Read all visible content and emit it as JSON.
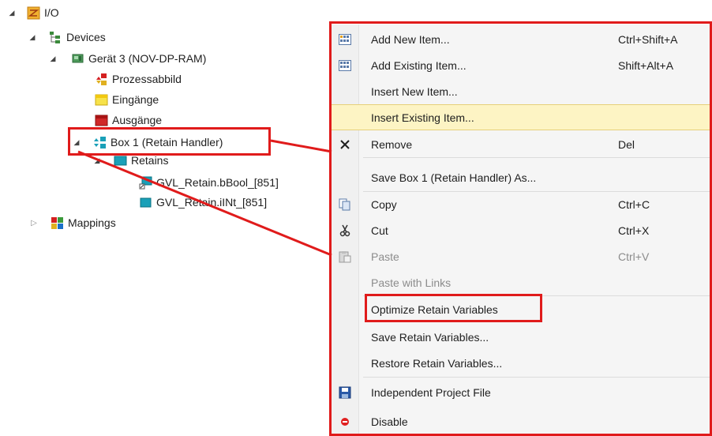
{
  "tree": {
    "io": "I/O",
    "devices": "Devices",
    "geraet": "Gerät 3 (NOV-DP-RAM)",
    "prozessabbild": "Prozessabbild",
    "eingaenge": "Eingänge",
    "ausgaenge": "Ausgänge",
    "box": "Box 1 (Retain Handler)",
    "retains": "Retains",
    "var1": "GVL_Retain.bBool_[851]",
    "var2": "GVL_Retain.iINt_[851]",
    "mappings": "Mappings"
  },
  "menu": {
    "add_new": {
      "label": "Add New Item...",
      "shortcut": "Ctrl+Shift+A"
    },
    "add_existing": {
      "label": "Add Existing Item...",
      "shortcut": "Shift+Alt+A"
    },
    "insert_new": {
      "label": "Insert New Item..."
    },
    "insert_existing": {
      "label": "Insert Existing Item..."
    },
    "remove": {
      "label": "Remove",
      "shortcut": "Del"
    },
    "save_as": {
      "label": "Save Box 1 (Retain Handler) As..."
    },
    "copy": {
      "label": "Copy",
      "shortcut": "Ctrl+C"
    },
    "cut": {
      "label": "Cut",
      "shortcut": "Ctrl+X"
    },
    "paste": {
      "label": "Paste",
      "shortcut": "Ctrl+V"
    },
    "paste_links": {
      "label": "Paste with Links"
    },
    "optimize": {
      "label": "Optimize Retain Variables"
    },
    "save_retain": {
      "label": "Save Retain Variables..."
    },
    "restore_retain": {
      "label": "Restore Retain Variables..."
    },
    "independent": {
      "label": "Independent Project File"
    },
    "disable": {
      "label": "Disable"
    }
  },
  "colors": {
    "annotation": "#e01b1b",
    "highlight": "#fdf4c4",
    "disabled_text": "#8c8c8c"
  }
}
